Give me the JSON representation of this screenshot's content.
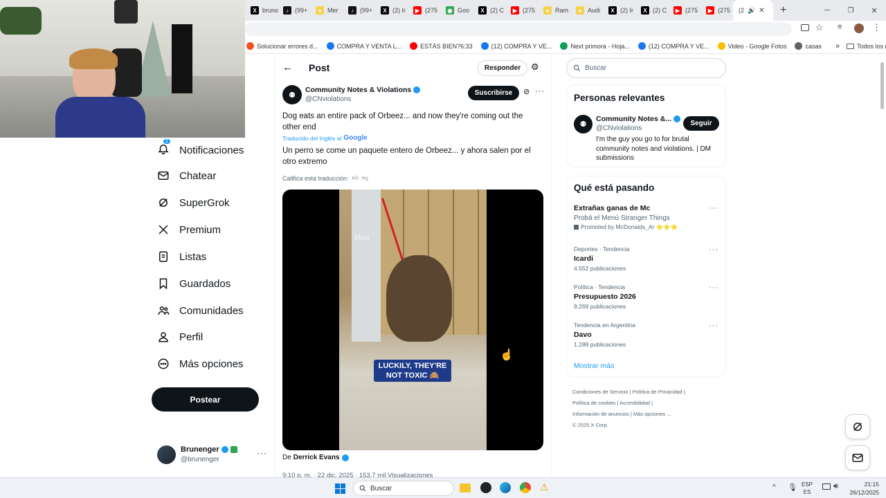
{
  "browser": {
    "tabs": [
      {
        "label": "bruno",
        "color": "#000000",
        "glyph": "X"
      },
      {
        "label": "(99+",
        "color": "#111111",
        "glyph": "♪"
      },
      {
        "label": "Mer",
        "color": "#f5d34b",
        "glyph": "●"
      },
      {
        "label": "(99+",
        "color": "#111111",
        "glyph": "♪"
      },
      {
        "label": "(2) Ir",
        "color": "#000000",
        "glyph": "X"
      },
      {
        "label": "(275",
        "color": "#ff0000",
        "glyph": "▶"
      },
      {
        "label": "Goo",
        "color": "#34a853",
        "glyph": "◉"
      },
      {
        "label": "(2) C",
        "color": "#000000",
        "glyph": "X"
      },
      {
        "label": "(275",
        "color": "#ff0000",
        "glyph": "▶"
      },
      {
        "label": "Ram",
        "color": "#f5d34b",
        "glyph": "●"
      },
      {
        "label": "Audi",
        "color": "#f5d34b",
        "glyph": "●"
      },
      {
        "label": "(2) Ir",
        "color": "#000000",
        "glyph": "X"
      },
      {
        "label": "(2) C",
        "color": "#000000",
        "glyph": "X"
      },
      {
        "label": "(275",
        "color": "#ff0000",
        "glyph": "▶"
      },
      {
        "label": "(275",
        "color": "#ff0000",
        "glyph": "▶"
      }
    ],
    "active_tab": "(2",
    "new_tab": "+",
    "bookmarks": [
      {
        "label": "Solucionar errores d...",
        "color": "#f25022"
      },
      {
        "label": "COMPRA Y VENTA L...",
        "color": "#1877f2"
      },
      {
        "label": "ESTÁS BIEN?6:33",
        "color": "#ff0000"
      },
      {
        "label": "(12) COMPRA Y VE...",
        "color": "#1877f2"
      },
      {
        "label": "Next primora - Hoja...",
        "color": "#0f9d58"
      },
      {
        "label": "(12) COMPRA Y VE...",
        "color": "#1877f2"
      },
      {
        "label": "Video - Google Fotos",
        "color": "#fbbc05"
      },
      {
        "label": "casas",
        "color": "#5f6368"
      }
    ],
    "all_bookmarks": "Todos los marcadores"
  },
  "nav": {
    "notifications": "Notificaciones",
    "notifications_badge": "2",
    "chat": "Chatear",
    "supergrok": "SuperGrok",
    "premium": "Premium",
    "lists": "Listas",
    "bookmarks": "Guardados",
    "communities": "Comunidades",
    "profile": "Perfil",
    "more": "Más opciones",
    "post_button": "Postear",
    "account": {
      "name": "Brunenger",
      "handle": "@brunenger"
    }
  },
  "post": {
    "header_title": "Post",
    "reply_button": "Responder",
    "author_name": "Community Notes & Violations",
    "author_handle": "@CNviolations",
    "subscribe_button": "Suscribirse",
    "text": "Dog eats an entire pack of Orbeez... and now they're coming out the other end",
    "translated_by": "Traducido del Inglés al",
    "translated_brand": "Google",
    "translation": "Un perro se come un paquete entero de Orbeez... y ahora salen por el otro extremo",
    "rate_translation": "Califica esta traducción:",
    "video_caption": "LUCKILY, THEY'RE NOT TOXIC 🙈",
    "video_watermark": "Mail",
    "from_label": "De",
    "from_name": "Derrick Evans",
    "meta": "9:10 p. m. · 22 dic. 2025 · 153,7 mil Visualizaciones"
  },
  "search": {
    "placeholder": "Buscar"
  },
  "relevant": {
    "title": "Personas relevantes",
    "name": "Community Notes &...",
    "handle": "@CNviolations",
    "follow_button": "Seguir",
    "bio": "I'm the guy you go to for brutal community notes and violations. | DM submissions"
  },
  "trends": {
    "title": "Qué está pasando",
    "items": [
      {
        "meta": "",
        "title": "Extrañas ganas de Mc",
        "sub": "Probá el Menú Stranger Things",
        "promo": "Promoted by McDonalds_Ar ⭐⭐⭐"
      },
      {
        "meta": "Deportes · Tendencia",
        "title": "Icardi",
        "sub": "4.552 publicaciones",
        "promo": ""
      },
      {
        "meta": "Política · Tendencia",
        "title": "Presupuesto 2026",
        "sub": "9.269 publicaciones",
        "promo": ""
      },
      {
        "meta": "Tendencia en Argentina",
        "title": "Davo",
        "sub": "1.289 publicaciones",
        "promo": ""
      }
    ],
    "show_more": "Mostrar más"
  },
  "footer": {
    "terms": "Condiciones de Servicio",
    "privacy": "Política de Privacidad",
    "cookies": "Política de cookies",
    "accessibility": "Accesibilidad",
    "ads": "Información de anuncios",
    "more": "Más opciones ...",
    "copyright": "© 2025 X Corp."
  },
  "taskbar": {
    "search": "Buscar",
    "lang": "ESP",
    "lang_sub": "ES",
    "time": "21:15",
    "date": "26/12/2025"
  },
  "colors": {
    "verified": "#1d9bf0",
    "link": "#1d9bf0",
    "accent": "#0f1419"
  }
}
